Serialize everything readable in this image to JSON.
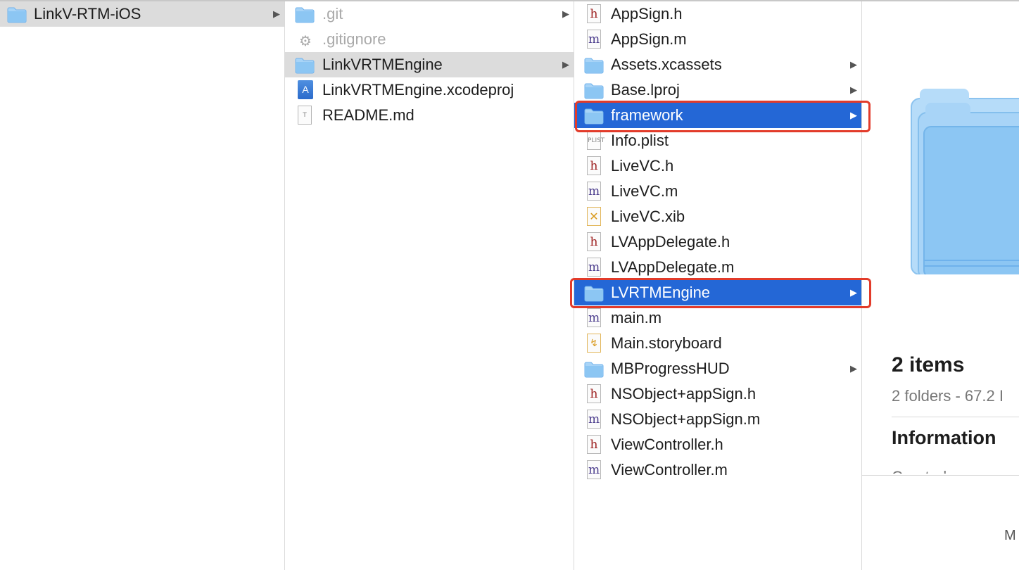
{
  "columns": {
    "col1": [
      {
        "label": "LinkV-RTM-iOS",
        "icon": "folder-icon",
        "chevron": "▶",
        "state": "selected"
      }
    ],
    "col2": [
      {
        "label": ".git",
        "icon": "folder-icon",
        "chevron": "▶",
        "state": "dim"
      },
      {
        "label": ".gitignore",
        "icon": "gear-icon",
        "chevron": "",
        "state": "dim"
      },
      {
        "label": "LinkVRTMEngine",
        "icon": "folder-icon",
        "chevron": "▶",
        "state": "selected"
      },
      {
        "label": "LinkVRTMEngine.xcodeproj",
        "icon": "xcodeproj-icon",
        "chevron": "",
        "state": ""
      },
      {
        "label": "README.md",
        "icon": "text-file-icon",
        "chevron": "",
        "state": ""
      }
    ],
    "col3": [
      {
        "label": "AppSign.h",
        "icon": "header-file-icon",
        "chevron": "",
        "state": ""
      },
      {
        "label": "AppSign.m",
        "icon": "objc-file-icon",
        "chevron": "",
        "state": ""
      },
      {
        "label": "Assets.xcassets",
        "icon": "folder-icon",
        "chevron": "▶",
        "state": ""
      },
      {
        "label": "Base.lproj",
        "icon": "folder-icon",
        "chevron": "▶",
        "state": ""
      },
      {
        "label": "framework",
        "icon": "folder-icon",
        "chevron": "▶",
        "state": "highlighted"
      },
      {
        "label": "Info.plist",
        "icon": "plist-file-icon",
        "chevron": "",
        "state": ""
      },
      {
        "label": "LiveVC.h",
        "icon": "header-file-icon",
        "chevron": "",
        "state": ""
      },
      {
        "label": "LiveVC.m",
        "icon": "objc-file-icon",
        "chevron": "",
        "state": ""
      },
      {
        "label": "LiveVC.xib",
        "icon": "xib-file-icon",
        "chevron": "",
        "state": ""
      },
      {
        "label": "LVAppDelegate.h",
        "icon": "header-file-icon",
        "chevron": "",
        "state": ""
      },
      {
        "label": "LVAppDelegate.m",
        "icon": "objc-file-icon",
        "chevron": "",
        "state": ""
      },
      {
        "label": "LVRTMEngine",
        "icon": "folder-icon",
        "chevron": "▶",
        "state": "highlighted"
      },
      {
        "label": "main.m",
        "icon": "objc-file-icon",
        "chevron": "",
        "state": ""
      },
      {
        "label": "Main.storyboard",
        "icon": "storyboard-file-icon",
        "chevron": "",
        "state": ""
      },
      {
        "label": "MBProgressHUD",
        "icon": "folder-icon",
        "chevron": "▶",
        "state": ""
      },
      {
        "label": "NSObject+appSign.h",
        "icon": "header-file-icon",
        "chevron": "",
        "state": ""
      },
      {
        "label": "NSObject+appSign.m",
        "icon": "objc-file-icon",
        "chevron": "",
        "state": ""
      },
      {
        "label": "ViewController.h",
        "icon": "header-file-icon",
        "chevron": "",
        "state": ""
      },
      {
        "label": "ViewController.m",
        "icon": "objc-file-icon",
        "chevron": "",
        "state": ""
      }
    ]
  },
  "preview": {
    "icon": "folder-stack-icon",
    "items_title": "2 items",
    "items_sub": "2 folders - 67.2 I",
    "info_title": "Information",
    "info_cut_text": "Created",
    "more_label": "M"
  },
  "icon_glyphs": {
    "header": "h",
    "objc": "m",
    "xib": "✕",
    "storyboard": "↯",
    "plist": "PLIST",
    "text": "T",
    "xcodeproj": "A",
    "gear": "⚙"
  },
  "colors": {
    "selection_blue": "#2467d6",
    "selection_grey": "#dcdcdc",
    "highlight_red": "#e23b2a",
    "folder_light": "#a8d4f7",
    "folder_dark": "#6fb2ec"
  }
}
